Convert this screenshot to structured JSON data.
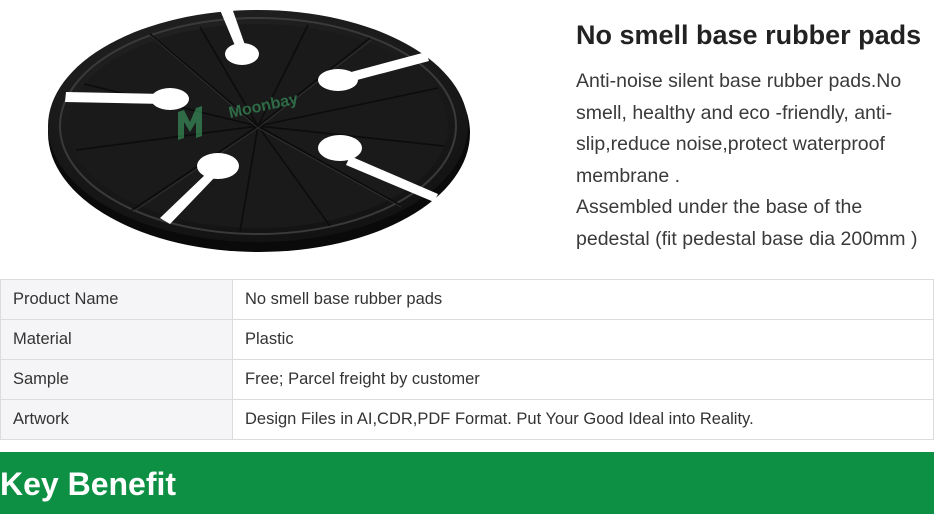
{
  "product": {
    "image_alt": "Black round rubber base pad with white slots",
    "watermark": "Moonbay",
    "title": "No smell base rubber pads",
    "description": [
      "Anti-noise silent base rubber pads.No smell, healthy and eco -friendly, anti-slip,reduce noise,protect waterproof membrane .",
      "Assembled under the base of the pedestal (fit pedestal base dia 200mm )"
    ]
  },
  "specs": [
    {
      "label": "Product Name",
      "value": "No smell base rubber pads"
    },
    {
      "label": "Material",
      "value": "Plastic"
    },
    {
      "label": "Sample",
      "value": "Free; Parcel freight by customer"
    },
    {
      "label": "Artwork",
      "value": "Design Files in AI,CDR,PDF Format. Put Your Good Ideal into Reality."
    }
  ],
  "section": {
    "title": "Key Benefit"
  },
  "colors": {
    "accent_green": "#0d9044",
    "pad_black": "#1c1c1c",
    "watermark_green": "#3fae6a"
  }
}
